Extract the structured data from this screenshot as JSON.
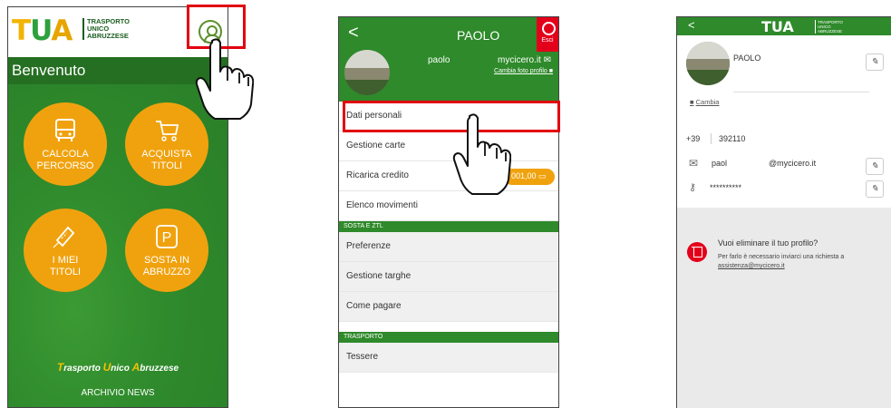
{
  "screen1": {
    "logo": {
      "t": "T",
      "u": "U",
      "a": "A",
      "sub": [
        "TRASPORTO",
        "UNICO",
        "ABRUZZESE"
      ]
    },
    "welcome": "Benvenuto",
    "tiles": [
      {
        "line1": "CALCOLA",
        "line2": "PERCORSO",
        "icon": "bus-icon"
      },
      {
        "line1": "ACQUISTA",
        "line2": "TITOLI",
        "icon": "cart-icon"
      },
      {
        "line1": "I MIEI",
        "line2": "TITOLI",
        "icon": "ticket-icon"
      },
      {
        "line1": "SOSTA IN",
        "line2": "ABRUZZO",
        "icon": "parking-icon"
      }
    ],
    "tagline": {
      "t": "T",
      "rasporto": "rasporto ",
      "u": "U",
      "nico": "nico ",
      "a": "A",
      "bruzzese": "bruzzese"
    },
    "news": "ARCHIVIO NEWS"
  },
  "screen2": {
    "back": "<",
    "name": "PAOLO",
    "exit": "Esci",
    "email_left": "paolo",
    "email_right": "mycicero.it",
    "change_photo": "Cambia foto profilo",
    "menu": [
      "Dati personali",
      "Gestione carte",
      "Ricarica credito",
      "Elenco movimenti"
    ],
    "credit": "001,00",
    "section_sosta": "SOSTA E ZTL",
    "menu_sosta": [
      "Preferenze",
      "Gestione targhe",
      "Come pagare"
    ],
    "section_trasporto": "TRASPORTO",
    "menu_trasporto": [
      "Tessere"
    ]
  },
  "screen3": {
    "back": "<",
    "logo": "TUA",
    "logo_sub": [
      "TRASPORTO",
      "UNICO",
      "ABRUZZESE"
    ],
    "name": "PAOLO",
    "change": "Cambia",
    "prefix": "+39",
    "phone": "392110",
    "email_left": "paol",
    "email_right": "@mycicero.it",
    "password": "**********",
    "delete_title": "Vuoi eliminare il tuo profilo?",
    "delete_text": "Per farlo è necessario inviarci una richiesta a",
    "delete_mail": "assistenza@mycicero.it"
  },
  "colors": {
    "green": "#2e8a2a",
    "orange": "#f0a20e",
    "highlight": "#e3000f"
  }
}
